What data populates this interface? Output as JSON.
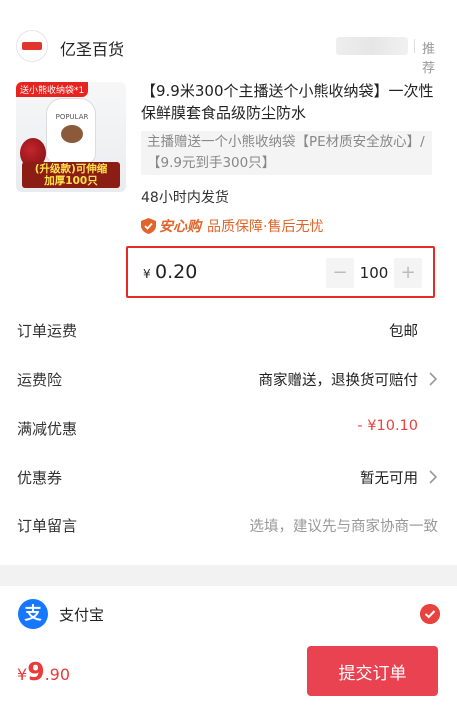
{
  "store": {
    "name": "亿圣百货",
    "recommend": "推荐"
  },
  "product": {
    "title": "【9.9米300个主播送个小熊收纳袋】一次性保鲜膜套食品级防尘防水",
    "subtitle": "主播赠送一个小熊收纳袋【PE材质安全放心】/【9.9元到手300只】",
    "shipping_time": "48小时内发货",
    "assure_brand": "安心购",
    "assure_text": "品质保障·售后无忧",
    "thumb_tag": "送小熊收纳袋*1",
    "thumb_brand": "POPULAR",
    "thumb_banner_line1": "(升级款)可伸缩",
    "thumb_banner_line2": "加厚100只"
  },
  "price": {
    "currency": "¥",
    "value": "0.20",
    "quantity": "100",
    "minus": "−",
    "plus": "+"
  },
  "rows": [
    {
      "label": "订单运费",
      "value": "包邮"
    },
    {
      "label": "运费险",
      "value": "商家赠送，退换货可赔付"
    },
    {
      "label": "满减优惠",
      "value": "- ¥10.10"
    },
    {
      "label": "优惠券",
      "value": "暂无可用"
    },
    {
      "label": "订单留言",
      "value": "选填，建议先与商家协商一致"
    }
  ],
  "payment": {
    "logo_char": "支",
    "name": "支付宝"
  },
  "footer": {
    "currency": "¥",
    "total_int": "9",
    "total_dec": ".90",
    "submit_label": "提交订单"
  },
  "colors": {
    "accent": "#e94250",
    "price_red": "#e83b3a",
    "highlight_border": "#e52b26",
    "assure_orange": "#e0652b",
    "alipay_blue": "#1677ff"
  }
}
